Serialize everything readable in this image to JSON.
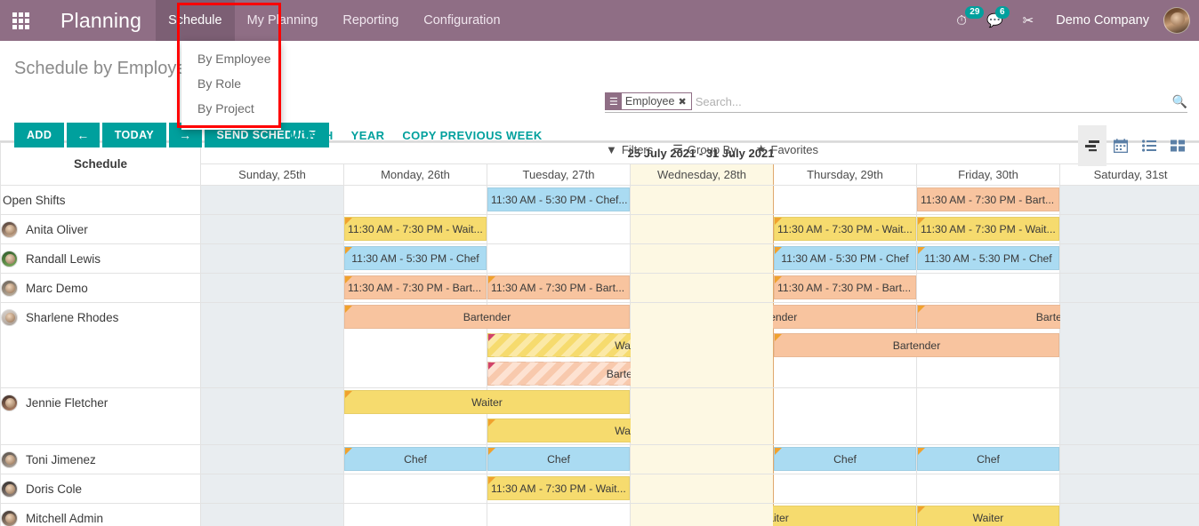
{
  "navbar": {
    "apps_icon": "apps-grid-icon",
    "brand": "Planning",
    "menu": [
      {
        "label": "Schedule",
        "open": true
      },
      {
        "label": "My Planning",
        "open": false
      },
      {
        "label": "Reporting",
        "open": false
      },
      {
        "label": "Configuration",
        "open": false
      }
    ],
    "activity_icon": "clock-activity-icon",
    "activity_count": "29",
    "messages_icon": "chat-messages-icon",
    "messages_count": "6",
    "debug_icon": "developer-tools-icon",
    "company": "Demo Company",
    "avatar": "user-avatar"
  },
  "dropdown": {
    "items": [
      "By Employee",
      "By Role",
      "By Project"
    ]
  },
  "control_panel": {
    "title": "Schedule by Employee",
    "buttons": {
      "add": "ADD",
      "prev": "←",
      "today": "TODAY",
      "next": "→",
      "send_schedule": "SEND SCHEDULE"
    },
    "scales": [
      "MONTH",
      "YEAR",
      "COPY PREVIOUS WEEK"
    ],
    "search": {
      "facet_icon": "group-by-icon",
      "facet_label": "Employee",
      "facet_remove": "✖",
      "placeholder": "Search...",
      "magnifier": "search-icon"
    },
    "filters": [
      {
        "icon": "filter-icon",
        "glyph": "▼",
        "label": "Filters"
      },
      {
        "icon": "group-by-icon",
        "glyph": "☰",
        "label": "Group By"
      },
      {
        "icon": "star-icon",
        "glyph": "★",
        "label": "Favorites"
      }
    ],
    "views": [
      {
        "name": "gantt-view",
        "active": true
      },
      {
        "name": "calendar-view",
        "active": false
      },
      {
        "name": "list-view",
        "active": false
      },
      {
        "name": "kanban-view",
        "active": false
      }
    ]
  },
  "gantt": {
    "side_header": "Schedule",
    "range": "25 July 2021 - 31 July 2021",
    "days": [
      {
        "label": "Sunday, 25th",
        "weekend": true,
        "today": false
      },
      {
        "label": "Monday, 26th",
        "weekend": false,
        "today": false
      },
      {
        "label": "Tuesday, 27th",
        "weekend": false,
        "today": false
      },
      {
        "label": "Wednesday, 28th",
        "weekend": false,
        "today": true
      },
      {
        "label": "Thursday, 29th",
        "weekend": false,
        "today": false
      },
      {
        "label": "Friday, 30th",
        "weekend": false,
        "today": false
      },
      {
        "label": "Saturday, 31st",
        "weekend": true,
        "today": false
      }
    ],
    "rows": [
      {
        "name": "Open Shifts",
        "avatar": null,
        "sublanes": 1,
        "shifts": [
          {
            "lane": 0,
            "start": 2,
            "span": 1,
            "label": "11:30 AM - 5:30 PM - Chef...",
            "color": "blue",
            "align": "lead",
            "flag": false
          },
          {
            "lane": 0,
            "start": 5,
            "span": 1,
            "label": "11:30 AM - 7:30 PM - Bart...",
            "color": "orange",
            "align": "lead",
            "flag": false
          }
        ]
      },
      {
        "name": "Anita Oliver",
        "avatar": "a1",
        "sublanes": 1,
        "shifts": [
          {
            "lane": 0,
            "start": 1,
            "span": 1,
            "label": "11:30 AM - 7:30 PM - Wait...",
            "color": "yellow",
            "align": "lead",
            "flag": true
          },
          {
            "lane": 0,
            "start": 3,
            "span": 1,
            "label": "11:30 AM - 7:30 PM - Wait...",
            "color": "yellow",
            "align": "lead",
            "flag": true
          },
          {
            "lane": 0,
            "start": 4,
            "span": 1,
            "label": "11:30 AM - 7:30 PM - Wait...",
            "color": "yellow",
            "align": "lead",
            "flag": true
          },
          {
            "lane": 0,
            "start": 5,
            "span": 1,
            "label": "11:30 AM - 7:30 PM - Wait...",
            "color": "yellow",
            "align": "lead",
            "flag": true
          }
        ]
      },
      {
        "name": "Randall Lewis",
        "avatar": "a2",
        "sublanes": 1,
        "shifts": [
          {
            "lane": 0,
            "start": 1,
            "span": 1,
            "label": "11:30 AM - 5:30 PM - Chef",
            "color": "blue",
            "align": "center",
            "flag": true
          },
          {
            "lane": 0,
            "start": 3,
            "span": 1,
            "label": "11:30 AM - 5:30 PM - Chef",
            "color": "blue",
            "align": "center",
            "flag": true
          },
          {
            "lane": 0,
            "start": 4,
            "span": 1,
            "label": "11:30 AM - 5:30 PM - Chef",
            "color": "blue",
            "align": "center",
            "flag": true
          },
          {
            "lane": 0,
            "start": 5,
            "span": 1,
            "label": "11:30 AM - 5:30 PM - Chef",
            "color": "blue",
            "align": "center",
            "flag": true
          }
        ]
      },
      {
        "name": "Marc Demo",
        "avatar": "a3",
        "sublanes": 1,
        "shifts": [
          {
            "lane": 0,
            "start": 1,
            "span": 1,
            "label": "11:30 AM - 7:30 PM - Bart...",
            "color": "orange",
            "align": "lead",
            "flag": true
          },
          {
            "lane": 0,
            "start": 2,
            "span": 1,
            "label": "11:30 AM - 7:30 PM - Bart...",
            "color": "orange",
            "align": "lead",
            "flag": true
          },
          {
            "lane": 0,
            "start": 3,
            "span": 1,
            "label": "11:30 AM - 7:30 PM - Bart...",
            "color": "orange",
            "align": "lead",
            "flag": true
          },
          {
            "lane": 0,
            "start": 4,
            "span": 1,
            "label": "11:30 AM - 7:30 PM - Bart...",
            "color": "orange",
            "align": "lead",
            "flag": true
          }
        ]
      },
      {
        "name": "Sharlene Rhodes",
        "avatar": "a4",
        "sublanes": 3,
        "shifts": [
          {
            "lane": 0,
            "start": 1,
            "span": 2,
            "label": "Bartender",
            "color": "orange",
            "align": "center",
            "flag": true
          },
          {
            "lane": 0,
            "start": 3,
            "span": 2,
            "label": "Bartender",
            "color": "orange",
            "align": "center",
            "flag": true
          },
          {
            "lane": 0,
            "start": 5,
            "span": 2,
            "label": "Bartender",
            "color": "orange",
            "align": "center",
            "flag": true
          },
          {
            "lane": 1,
            "start": 2,
            "span": 2,
            "label": "Waiter",
            "color": "yellow-h",
            "align": "center",
            "flag": true
          },
          {
            "lane": 1,
            "start": 4,
            "span": 2,
            "label": "Bartender",
            "color": "orange",
            "align": "center",
            "flag": true
          },
          {
            "lane": 2,
            "start": 2,
            "span": 2,
            "label": "Bartender",
            "color": "orange-h",
            "align": "center",
            "flag": true
          }
        ]
      },
      {
        "name": "Jennie Fletcher",
        "avatar": "a5",
        "sublanes": 2,
        "shifts": [
          {
            "lane": 0,
            "start": 1,
            "span": 2,
            "label": "Waiter",
            "color": "yellow",
            "align": "center",
            "flag": true
          },
          {
            "lane": 1,
            "start": 2,
            "span": 2,
            "label": "Waiter",
            "color": "yellow",
            "align": "center",
            "flag": true
          }
        ]
      },
      {
        "name": "Toni Jimenez",
        "avatar": "a6",
        "sublanes": 1,
        "shifts": [
          {
            "lane": 0,
            "start": 1,
            "span": 1,
            "label": "Chef",
            "color": "blue",
            "align": "center",
            "flag": true
          },
          {
            "lane": 0,
            "start": 2,
            "span": 1,
            "label": "Chef",
            "color": "blue",
            "align": "center",
            "flag": true
          },
          {
            "lane": 0,
            "start": 3,
            "span": 1,
            "label": "Chef",
            "color": "blue",
            "align": "center",
            "flag": true
          },
          {
            "lane": 0,
            "start": 4,
            "span": 1,
            "label": "Chef",
            "color": "blue",
            "align": "center",
            "flag": true
          },
          {
            "lane": 0,
            "start": 5,
            "span": 1,
            "label": "Chef",
            "color": "blue",
            "align": "center",
            "flag": true
          }
        ]
      },
      {
        "name": "Doris Cole",
        "avatar": "a7",
        "sublanes": 1,
        "shifts": [
          {
            "lane": 0,
            "start": 2,
            "span": 1,
            "label": "11:30 AM - 7:30 PM - Wait...",
            "color": "yellow",
            "align": "lead",
            "flag": true
          }
        ]
      },
      {
        "name": "Mitchell Admin",
        "avatar": "a8",
        "sublanes": 1,
        "shifts": [
          {
            "lane": 0,
            "start": 3,
            "span": 2,
            "label": "Waiter",
            "color": "yellow",
            "align": "center",
            "flag": true
          },
          {
            "lane": 0,
            "start": 5,
            "span": 1,
            "label": "Waiter",
            "color": "yellow",
            "align": "center",
            "flag": true
          }
        ]
      }
    ]
  }
}
